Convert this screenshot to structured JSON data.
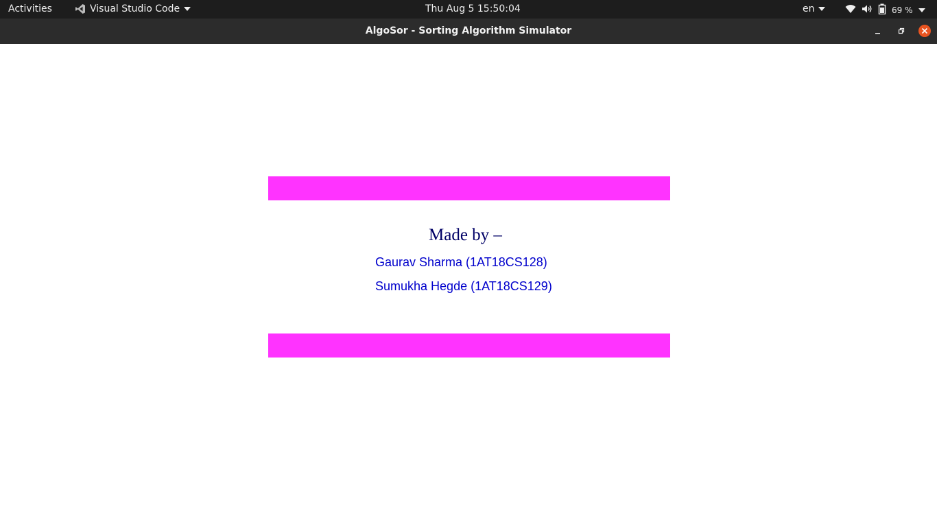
{
  "topbar": {
    "activities": "Activities",
    "app_name": "Visual Studio Code",
    "clock": "Thu Aug 5  15:50:04",
    "language": "en",
    "battery": "69 %"
  },
  "window": {
    "title": "AlgoSor - Sorting Algorithm Simulator"
  },
  "credits": {
    "heading": "Made by –",
    "authors": [
      "Gaurav Sharma (1AT18CS128)",
      "Sumukha Hegde (1AT18CS129)"
    ]
  },
  "colors": {
    "bar_color": "#ff33ff",
    "heading_color": "#000066",
    "author_color": "#0000cc",
    "close_button": "#e95420"
  },
  "icons": {
    "app": "vscode-icon",
    "wifi": "wifi-icon",
    "volume": "volume-icon",
    "battery": "battery-icon"
  }
}
